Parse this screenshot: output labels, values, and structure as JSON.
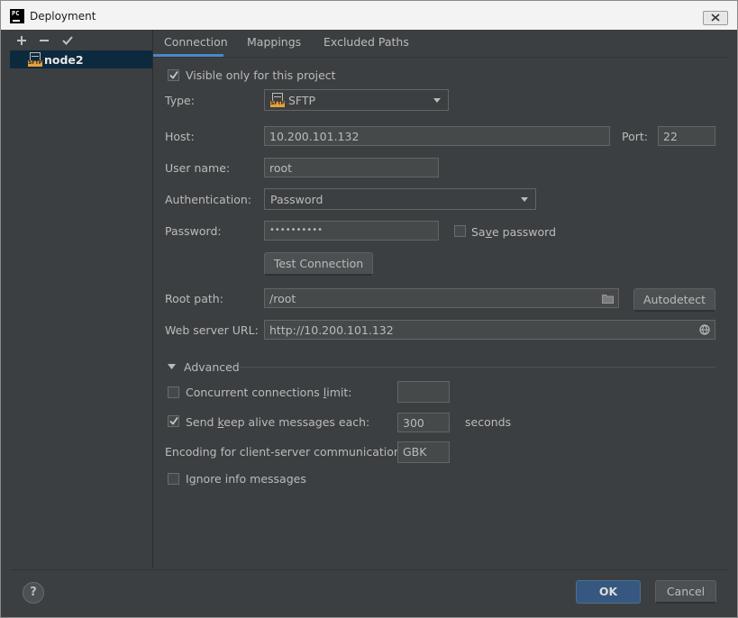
{
  "window": {
    "title": "Deployment",
    "app_icon_text": "PC"
  },
  "sidebar": {
    "toolbar": [
      "add-icon",
      "remove-icon",
      "check-icon"
    ],
    "items": [
      {
        "label": "node2",
        "icon": "sftp-icon",
        "icon_tag": "SFTP"
      }
    ]
  },
  "tabs": [
    "Connection",
    "Mappings",
    "Excluded Paths"
  ],
  "active_tab": 0,
  "form": {
    "visible_only": {
      "label": "Visible only for this project",
      "checked": true
    },
    "type": {
      "label": "Type:",
      "value": "SFTP",
      "icon_tag": "SFTP"
    },
    "host": {
      "label": "Host:",
      "value": "10.200.101.132"
    },
    "port": {
      "label": "Port:",
      "value": "22"
    },
    "username": {
      "label": "User name:",
      "value": "root"
    },
    "authentication": {
      "label": "Authentication:",
      "value": "Password"
    },
    "password": {
      "label": "Password:",
      "value": "••••••••••"
    },
    "save_password": {
      "label_pre": "Sa",
      "label_u": "v",
      "label_post": "e password",
      "checked": false
    },
    "test_connection": "Test Connection",
    "root_path": {
      "label": "Root path:",
      "value": "/root"
    },
    "autodetect": "Autodetect",
    "web_url": {
      "label": "Web server URL:",
      "value": "http://10.200.101.132"
    }
  },
  "advanced": {
    "title": "Advanced",
    "concurrent": {
      "label_pre": "Concurrent connections ",
      "label_u": "l",
      "label_post": "imit:",
      "checked": false,
      "value": ""
    },
    "keepalive": {
      "label_pre": "Send ",
      "label_u": "k",
      "label_post": "eep alive messages each:",
      "checked": true,
      "value": "300",
      "unit": "seconds"
    },
    "encoding": {
      "label": "Encoding for client-server communication:",
      "value": "GBK"
    },
    "ignore_info": {
      "label_pre": "I",
      "label_u": "g",
      "label_post": "nore info messages",
      "checked": false
    }
  },
  "footer": {
    "help": "?",
    "ok": "OK",
    "cancel": "Cancel"
  }
}
